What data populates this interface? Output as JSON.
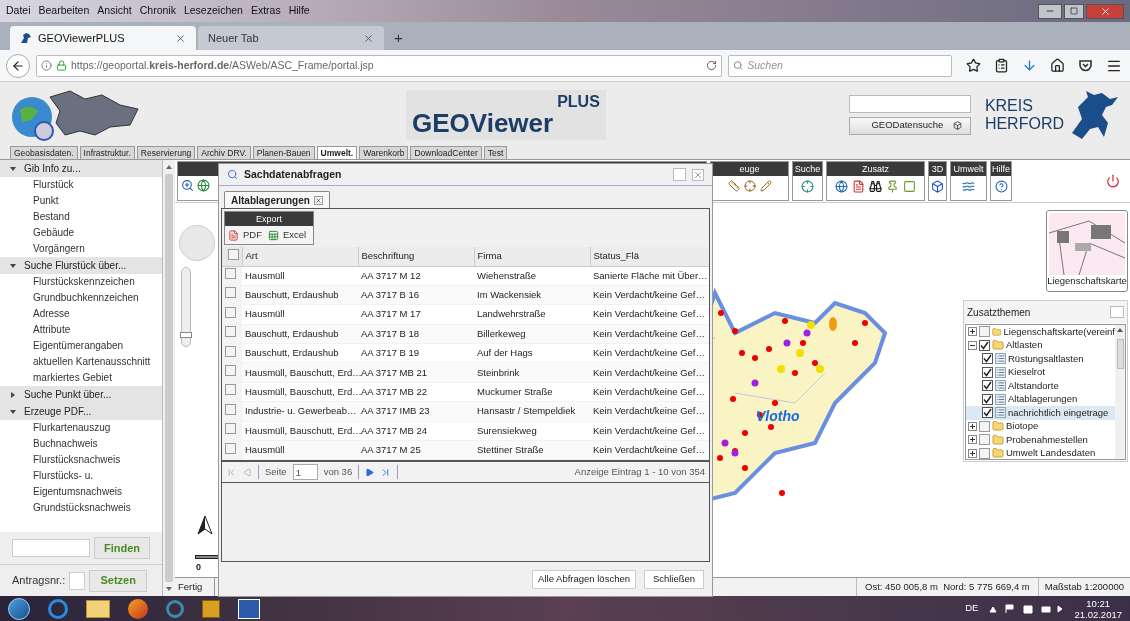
{
  "browser": {
    "menu": [
      "Datei",
      "Bearbeiten",
      "Ansicht",
      "Chronik",
      "Lesezeichen",
      "Extras",
      "Hilfe"
    ],
    "tabs": [
      {
        "label": "GEOViewerPLUS",
        "selected": true
      },
      {
        "label": "Neuer Tab",
        "selected": false
      }
    ],
    "new_tab": "+",
    "url": "https://geoportal.**kreis-herford.de**/ASWeb/ASC_Frame/portal.jsp",
    "search_placeholder": "Suchen"
  },
  "header": {
    "title": "GEOViewer",
    "title_sup": "PLUS",
    "search_button": "GEODatensuche",
    "brand_line1": "KREIS",
    "brand_line2": "HERFORD"
  },
  "portal_tabs": [
    {
      "label": "Geobasisdaten.",
      "selected": false
    },
    {
      "label": "Infrastruktur.",
      "selected": false
    },
    {
      "label": "Reservierung",
      "selected": false
    },
    {
      "label": "Archiv DRV.",
      "selected": false
    },
    {
      "label": "Planen-Bauen",
      "selected": false
    },
    {
      "label": "Umwelt.",
      "selected": true
    },
    {
      "label": "Warenkorb",
      "selected": false
    },
    {
      "label": "DownloadCenter",
      "selected": false
    },
    {
      "label": "Test",
      "selected": false
    }
  ],
  "sidebar": {
    "sections": [
      {
        "title": "Gib Info zu...",
        "expanded": true,
        "items": [
          "Flurstück",
          "Punkt",
          "Bestand",
          "Gebäude",
          "Vorgängern"
        ]
      },
      {
        "title": "Suche Flurstück über...",
        "expanded": true,
        "items": [
          "Flurstückskennzeichen",
          "Grundbuchkennzeichen",
          "Adresse",
          "Attribute",
          "Eigentümerangaben",
          "aktuellen Kartenausschnitt",
          "markiertes Gebiet"
        ]
      },
      {
        "title": "Suche Punkt über...",
        "expanded": false
      },
      {
        "title": "Erzeuge PDF...",
        "expanded": true,
        "items": [
          "Flurkartenauszug",
          "Buchnachweis",
          "Flurstücksnachweis",
          "Flurstücks- u. Eigentumsnachweis",
          "Grundstücksnachweis"
        ]
      }
    ],
    "find_button": "Finden",
    "antrag_label": "Antragsnr.:",
    "set_button": "Setzen"
  },
  "toolbar_groups": [
    "euge",
    "Suche",
    "Zusatz",
    "3D",
    "Umwelt",
    "Hilfe"
  ],
  "map": {
    "zoom": {
      "level": 0.1
    },
    "place_label": "Vlotho",
    "scale_label": "0",
    "thumbnail_label": "Liegenschaftskarte",
    "status": "Fertig",
    "coords": "Ost: 450 005,8 m  Nord: 5 775 669,4 m",
    "scale": "Maßstab 1:200000"
  },
  "layers": {
    "title": "Zusatzthemen",
    "items": [
      {
        "label": "Liegenschaftskarte(vereinf",
        "kind": "folder",
        "checked": false,
        "expanded": false,
        "selected": false
      },
      {
        "label": "Altlasten",
        "kind": "folder",
        "checked": true,
        "expanded": true,
        "selected": false,
        "children": [
          {
            "label": "Rüstungsaltlasten",
            "kind": "layer",
            "checked": true,
            "selected": false
          },
          {
            "label": "Kieselrot",
            "kind": "layer",
            "checked": true,
            "selected": false
          },
          {
            "label": "Altstandorte",
            "kind": "layer",
            "checked": true,
            "selected": false
          },
          {
            "label": "Altablagerungen",
            "kind": "layer",
            "checked": true,
            "selected": false
          },
          {
            "label": "nachrichtlich eingetrage",
            "kind": "layer",
            "checked": true,
            "selected": true
          }
        ]
      },
      {
        "label": "Biotope",
        "kind": "folder",
        "checked": false,
        "expanded": false,
        "selected": false
      },
      {
        "label": "Probenahmestellen",
        "kind": "folder",
        "checked": false,
        "expanded": false,
        "selected": false
      },
      {
        "label": "Umwelt Landesdaten",
        "kind": "folder",
        "checked": false,
        "expanded": false,
        "selected": false
      }
    ]
  },
  "dialog": {
    "title": "Sachdatenabfragen",
    "tab": {
      "label": "Altablagerungen",
      "selected": true
    },
    "export_title": "Export",
    "export_pdf": "PDF",
    "export_excel": "Excel",
    "columns": [
      "Art",
      "Beschriftung",
      "Firma",
      "Status_Flä"
    ],
    "all_checked": false,
    "rows": [
      {
        "checked": false,
        "cells": [
          "Hausmüll",
          "AA 3717 M 12",
          "Wiehenstraße",
          "Sanierte Fläche mit Über…"
        ]
      },
      {
        "checked": false,
        "cells": [
          "Bauschutt, Erdaushub",
          "AA 3717 B 16",
          "Im Wackensiek",
          "Kein Verdacht/keine Gef…"
        ]
      },
      {
        "checked": false,
        "cells": [
          "Hausmüll",
          "AA 3717 M 17",
          "Landwehrstraße",
          "Kein Verdacht/keine Gef…"
        ]
      },
      {
        "checked": false,
        "cells": [
          "Bauschutt, Erdaushub",
          "AA 3717 B 18",
          "Billerkeweg",
          "Kein Verdacht/keine Gef…"
        ]
      },
      {
        "checked": false,
        "cells": [
          "Bauschutt, Erdaushub",
          "AA 3717 B 19",
          "Auf der Hags",
          "Kein Verdacht/keine Gef…"
        ]
      },
      {
        "checked": false,
        "cells": [
          "Hausmüll, Bauschutt, Erd…",
          "AA 3717 MB 21",
          "Steinbrink",
          "Kein Verdacht/keine Gef…"
        ]
      },
      {
        "checked": false,
        "cells": [
          "Hausmüll, Bauschutt, Erd…",
          "AA 3717 MB 22",
          "Muckumer Straße",
          "Kein Verdacht/keine Gef…"
        ]
      },
      {
        "checked": false,
        "cells": [
          "Industrie- u. Gewerbeab…",
          "AA 3717 IMB 23",
          "Hansastr / Stempeldiek",
          "Kein Verdacht/keine Gef…"
        ]
      },
      {
        "checked": false,
        "cells": [
          "Hausmüll, Bauschutt, Erd…",
          "AA 3717 MB 24",
          "Surensiekweg",
          "Kein Verdacht/keine Gef…"
        ]
      },
      {
        "checked": false,
        "cells": [
          "Hausmüll",
          "AA 3717 M 25",
          "Stettiner Straße",
          "Kein Verdacht/keine Gef…"
        ]
      }
    ],
    "page_label": "Seite",
    "page": "1",
    "page_total": "von 36",
    "summary": "Anzeige Eintrag 1 - 10 von 354",
    "clear_button": "Alle Abfragen löschen",
    "close_button": "Schließen"
  },
  "taskbar": {
    "language": "DE",
    "time": "10:21",
    "date": "21.02.2017"
  }
}
